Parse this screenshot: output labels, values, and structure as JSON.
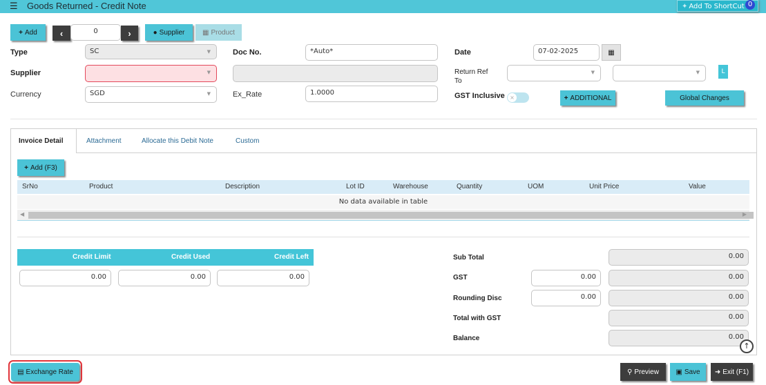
{
  "window": {
    "title": "Goods Returned - Credit Note",
    "shortcut_label": "Add To ShortCut",
    "shortcut_count": "0"
  },
  "toolbar": {
    "add_label": "Add",
    "record_index": "0",
    "supplier_label": "Supplier",
    "product_label": "Product"
  },
  "form": {
    "type_label": "Type",
    "type_value": "SC",
    "supplier_label": "Supplier",
    "currency_label": "Currency",
    "currency_value": "SGD",
    "docno_label": "Doc No.",
    "docno_value": "*Auto*",
    "exrate_label": "Ex_Rate",
    "exrate_value": "1.0000",
    "date_label": "Date",
    "date_value": "07-02-2025",
    "returnref_label_1": "Return Ref",
    "returnref_label_2": "To",
    "gst_inclusive_label": "GST Inclusive",
    "additional_label": "ADDITIONAL",
    "global_changes_label": "Global Changes",
    "side_tag": "L"
  },
  "tabs": [
    "Invoice Detail",
    "Attachment",
    "Allocate this Debit Note",
    "Custom"
  ],
  "grid": {
    "add_label": "Add (F3)",
    "columns": [
      "SrNo",
      "Product",
      "Description",
      "Lot ID",
      "Warehouse",
      "Quantity",
      "UOM",
      "Unit Price",
      "Value"
    ],
    "empty_text": "No data available in table"
  },
  "credit": {
    "headers": [
      "Credit Limit",
      "Credit Used",
      "Credit Left"
    ],
    "values": [
      "0.00",
      "0.00",
      "0.00"
    ]
  },
  "totals": {
    "subtotal_label": "Sub Total",
    "subtotal_value": "0.00",
    "gst_label": "GST",
    "gst_rate": "0.00",
    "gst_value": "0.00",
    "rounding_label": "Rounding Disc",
    "rounding_rate": "0.00",
    "rounding_value": "0.00",
    "total_gst_label": "Total with GST",
    "total_gst_value": "0.00",
    "balance_label": "Balance",
    "balance_value": "0.00"
  },
  "footer": {
    "exchange_rate_label": "Exchange Rate",
    "preview_label": "Preview",
    "save_label": "Save",
    "exit_label": "Exit (F1)"
  },
  "colors": {
    "accent": "#4bc3d6",
    "titlebar": "#50c6d8",
    "error_bg": "#fde0e3",
    "highlight_border": "#e0343a"
  }
}
